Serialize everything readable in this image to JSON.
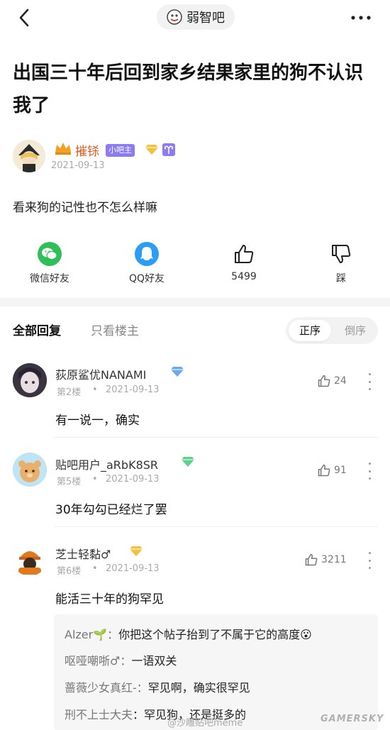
{
  "header": {
    "forum_name": "弱智吧"
  },
  "post": {
    "title": "出国三十年后回到家乡结果家里的狗不认识我了",
    "author": {
      "name": "摧铩",
      "role_badge": "小吧主",
      "date": "2021-09-13"
    },
    "body": "看来狗的记性也不怎么样嘛"
  },
  "actions": [
    {
      "label": "微信好友",
      "icon": "wechat-icon",
      "color": "#2fbf59"
    },
    {
      "label": "QQ好友",
      "icon": "qq-icon",
      "color": "#2a9df4"
    },
    {
      "label": "5499",
      "icon": "thumbs-up-icon"
    },
    {
      "label": "踩",
      "icon": "thumbs-down-icon"
    }
  ],
  "replies_bar": {
    "tab_all": "全部回复",
    "tab_op_only": "只看楼主",
    "sort_asc": "正序",
    "sort_desc": "倒序"
  },
  "comments": [
    {
      "name": "荻原鲨优NANAMI",
      "floor": "第2楼",
      "date": "2021-09-13",
      "text": "有一说一，确实",
      "likes": "24"
    },
    {
      "name": "贴吧用户_aRbK8SR",
      "floor": "第5楼",
      "date": "2021-09-13",
      "text": "30年勾勾已经烂了罢",
      "likes": "91"
    },
    {
      "name": "芝士轻黏♂",
      "floor": "第6楼",
      "date": "2021-09-13",
      "text": "能活三十年的狗罕见",
      "likes": "3211"
    }
  ],
  "sub_replies": [
    {
      "name": "Alzer🌱：",
      "text": "你把这个帖子抬到了不属于它的高度😮"
    },
    {
      "name": "呕哑嘲哳♂：",
      "text": "一语双关"
    },
    {
      "name": "蔷薇少女真红-：",
      "text": "罕见啊，确实很罕见"
    },
    {
      "name": "刑不上士大夫",
      "text": "：罕见狗，还是挺多的"
    }
  ],
  "watermarks": {
    "weibo": "@沙雕贴吧meme",
    "site": "GAMERSKY"
  },
  "colors": {
    "accent_orange": "#e15a1c",
    "badge_purple": "#8b7cf6",
    "diamond_blue": "#6aa8f0",
    "diamond_green": "#5fcf8a",
    "diamond_gold": "#f2c23a"
  }
}
